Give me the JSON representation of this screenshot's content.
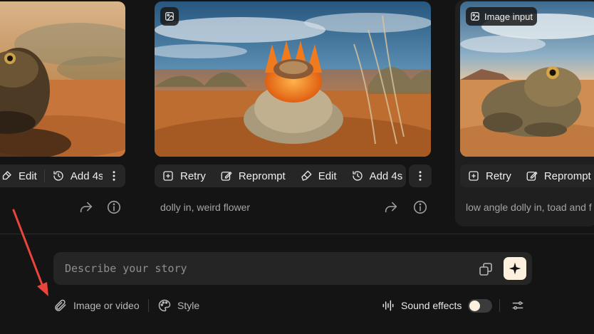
{
  "cards": [
    {
      "actions": [
        "Edit",
        "Add 4s"
      ],
      "more_icon": "more-vertical-icon"
    },
    {
      "actions": [
        "Retry",
        "Reprompt",
        "Edit",
        "Add 4s"
      ],
      "caption": "dolly in, weird flower",
      "more_icon": "more-vertical-icon"
    },
    {
      "badge": "Image input",
      "actions": [
        "Retry",
        "Reprompt"
      ],
      "caption": "low angle dolly in, toad and f"
    }
  ],
  "prompt": {
    "placeholder": "Describe your story"
  },
  "toolbar": {
    "attach_label": "Image or video",
    "style_label": "Style",
    "sound_label": "Sound effects",
    "sound_on": false
  },
  "colors": {
    "background": "#141414",
    "panel": "#262626",
    "accent": "#fdf0dc",
    "annotation_arrow": "#e8453c"
  }
}
